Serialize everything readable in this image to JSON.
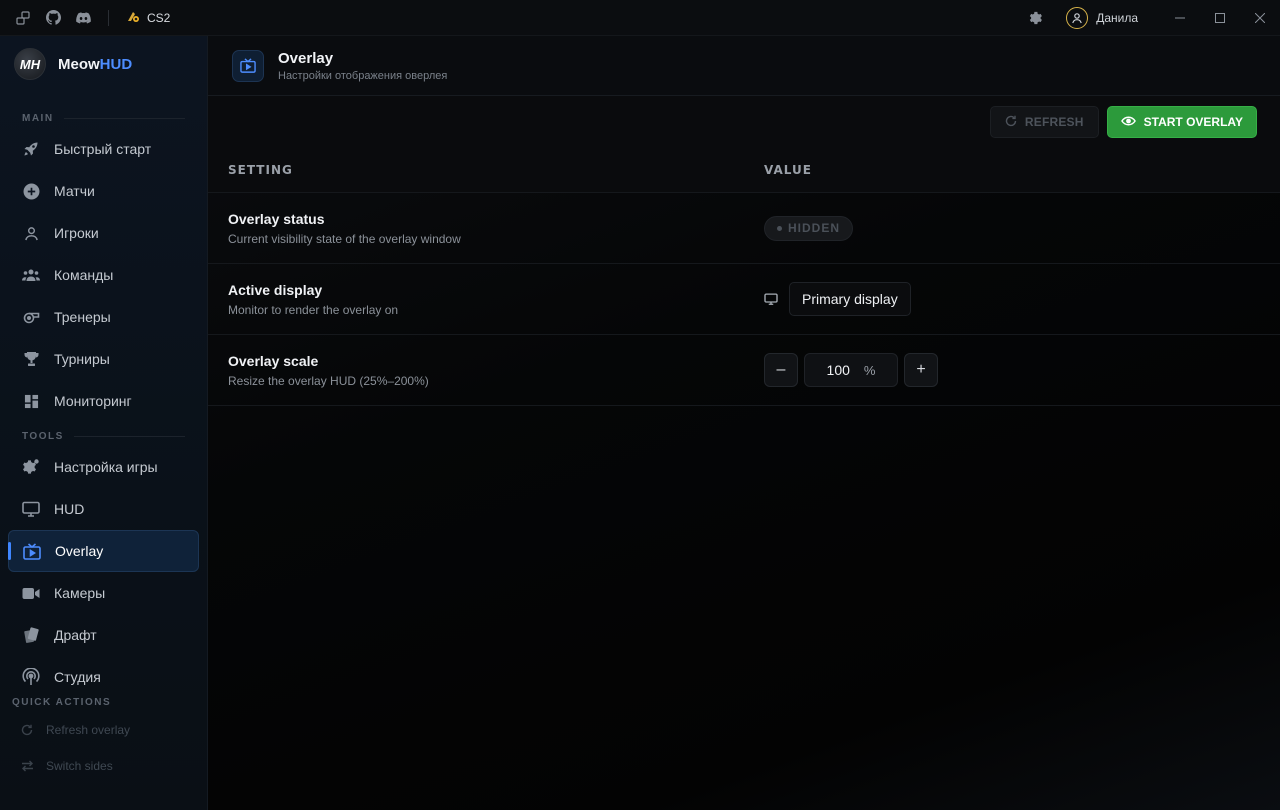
{
  "titlebar": {
    "game": "CS2",
    "user": "Данила"
  },
  "brand": {
    "logo_text": "MH",
    "name_main": "Meow",
    "name_accent": "HUD"
  },
  "sidebar": {
    "main_label": "MAIN",
    "main_items": [
      {
        "label": "Быстрый старт",
        "icon": "rocket-icon"
      },
      {
        "label": "Матчи",
        "icon": "plus-circle-icon"
      },
      {
        "label": "Игроки",
        "icon": "user-icon"
      },
      {
        "label": "Команды",
        "icon": "team-icon"
      },
      {
        "label": "Тренеры",
        "icon": "whistle-icon"
      },
      {
        "label": "Турниры",
        "icon": "trophy-icon"
      },
      {
        "label": "Мониторинг",
        "icon": "dashboard-icon"
      }
    ],
    "tools_label": "TOOLS",
    "tools_items": [
      {
        "label": "Настройка игры",
        "icon": "gears-icon"
      },
      {
        "label": "HUD",
        "icon": "monitor-icon"
      },
      {
        "label": "Overlay",
        "icon": "tv-play-icon"
      },
      {
        "label": "Камеры",
        "icon": "camera-icon"
      },
      {
        "label": "Драфт",
        "icon": "cards-icon"
      },
      {
        "label": "Студия",
        "icon": "broadcast-icon"
      }
    ],
    "quick_label": "QUICK ACTIONS",
    "quick_items": [
      {
        "label": "Refresh overlay",
        "icon": "refresh-icon"
      },
      {
        "label": "Switch sides",
        "icon": "swap-icon"
      }
    ]
  },
  "header": {
    "title": "Overlay",
    "subtitle": "Настройки отображения оверлея"
  },
  "toolbar": {
    "refresh_label": "REFRESH",
    "start_label": "START OVERLAY"
  },
  "table": {
    "col_setting": "SETTING",
    "col_value": "VALUE",
    "rows": {
      "status": {
        "title": "Overlay status",
        "sub": "Current visibility state of the overlay window",
        "value": "HIDDEN"
      },
      "display": {
        "title": "Active display",
        "sub": "Monitor to render the overlay on",
        "value": "Primary display"
      },
      "scale": {
        "title": "Overlay scale",
        "sub": "Resize the overlay HUD (25%–200%)",
        "value": "100",
        "unit": "%",
        "minus": "–",
        "plus": "+"
      }
    }
  },
  "colors": {
    "accent": "#4d8dff",
    "start_button": "#2c9a3b"
  }
}
